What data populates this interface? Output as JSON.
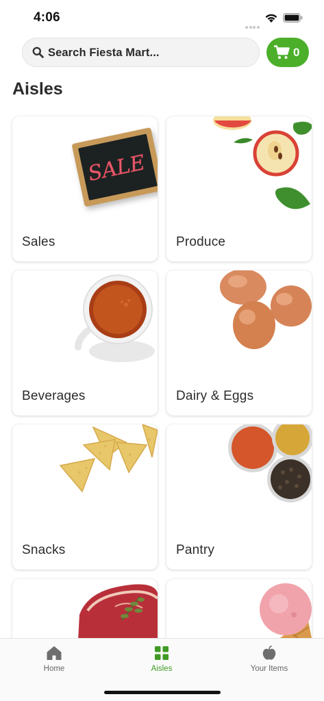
{
  "status_bar": {
    "time": "4:06"
  },
  "search": {
    "placeholder": "Search Fiesta Mart..."
  },
  "cart": {
    "count": "0"
  },
  "page": {
    "title": "Aisles"
  },
  "aisles": [
    {
      "label": "Sales",
      "icon": "sale-chalkboard"
    },
    {
      "label": "Produce",
      "icon": "apple"
    },
    {
      "label": "Beverages",
      "icon": "tea-cup"
    },
    {
      "label": "Dairy & Eggs",
      "icon": "eggs"
    },
    {
      "label": "Snacks",
      "icon": "tortilla-chips"
    },
    {
      "label": "Pantry",
      "icon": "spice-bowls"
    },
    {
      "label": "",
      "icon": "steak"
    },
    {
      "label": "",
      "icon": "ice-cream"
    }
  ],
  "tabs": [
    {
      "label": "Home",
      "icon": "home-icon",
      "active": false
    },
    {
      "label": "Aisles",
      "icon": "grid-icon",
      "active": true
    },
    {
      "label": "Your Items",
      "icon": "apple-icon",
      "active": false
    }
  ],
  "colors": {
    "accent": "#4caf2a",
    "active_tab": "#3f9a23"
  }
}
